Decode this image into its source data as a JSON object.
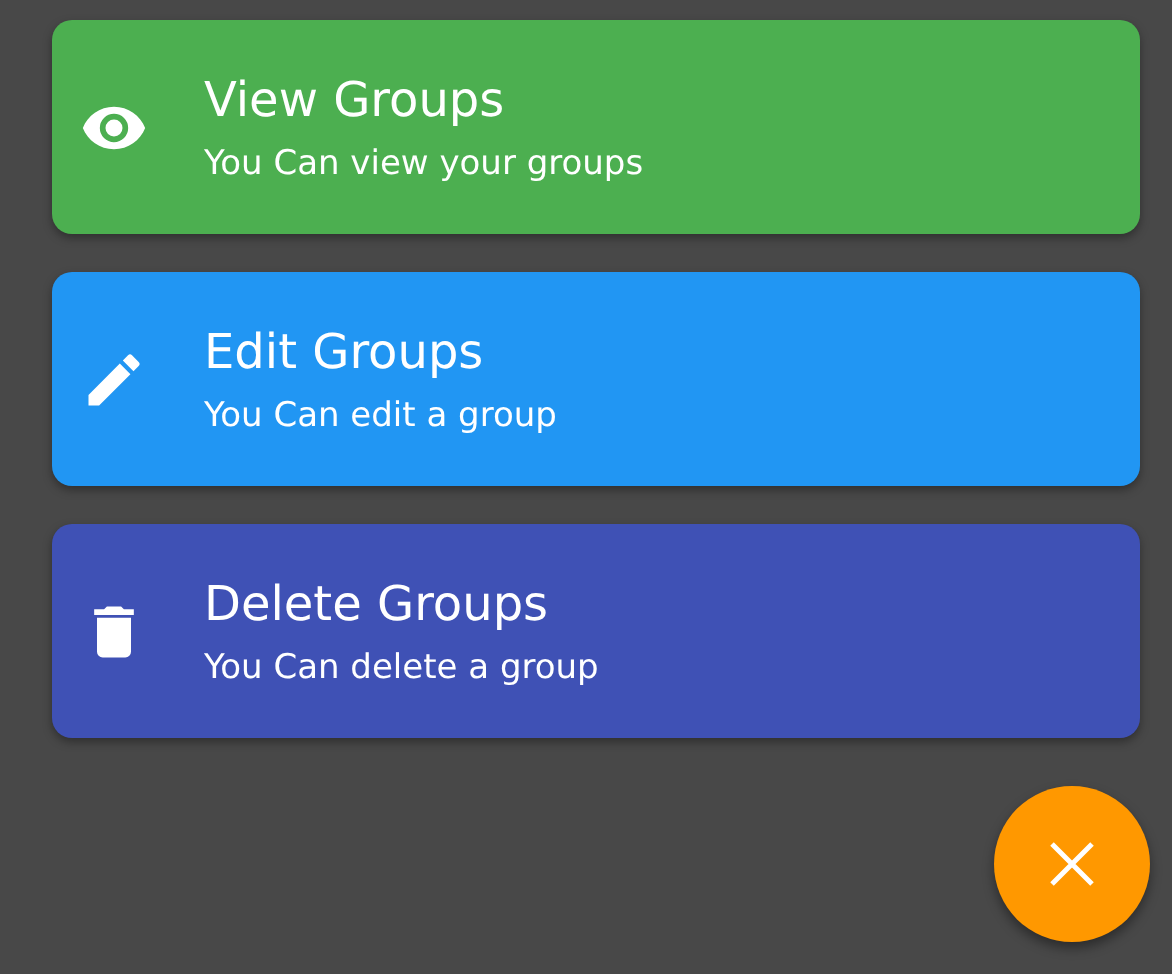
{
  "cards": [
    {
      "kind": "eye",
      "title": "View Groups",
      "subtitle": "You Can view your groups",
      "color": "#4caf50"
    },
    {
      "kind": "pencil",
      "title": "Edit Groups",
      "subtitle": "You Can edit a group",
      "color": "#2196f3"
    },
    {
      "kind": "trash",
      "title": "Delete Groups",
      "subtitle": "You Can delete a group",
      "color": "#3f51b5"
    }
  ]
}
